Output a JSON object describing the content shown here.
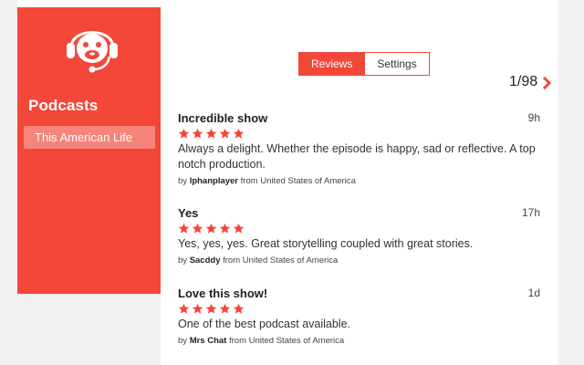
{
  "sidebar": {
    "heading": "Podcasts",
    "items": [
      {
        "label": "This American Life"
      }
    ]
  },
  "tabs": [
    {
      "label": "Reviews",
      "active": true
    },
    {
      "label": "Settings",
      "active": false
    }
  ],
  "pager": {
    "text": "1/98"
  },
  "reviews": [
    {
      "title": "Incredible show",
      "time": "9h",
      "rating": 5,
      "body": "Always a delight. Whether the episode is happy, sad or reflective. A top notch production.",
      "by": "by",
      "author": "Iphanplayer",
      "from": "from United States of America"
    },
    {
      "title": "Yes",
      "time": "17h",
      "rating": 5,
      "body": "Yes, yes, yes. Great storytelling coupled with great stories.",
      "by": "by",
      "author": "Sacddy",
      "from": "from United States of America"
    },
    {
      "title": "Love this show!",
      "time": "1d",
      "rating": 5,
      "body": "One of the best podcast available.",
      "by": "by",
      "author": "Mrs Chat",
      "from": "from United States of America"
    }
  ],
  "colors": {
    "accent": "#f3473a",
    "accent_light": "#f6847b",
    "background": "#f1f1f1"
  },
  "icons": {
    "logo": "headphone-monkey-logo",
    "next": "chevron-right-icon",
    "star": "star-icon"
  }
}
